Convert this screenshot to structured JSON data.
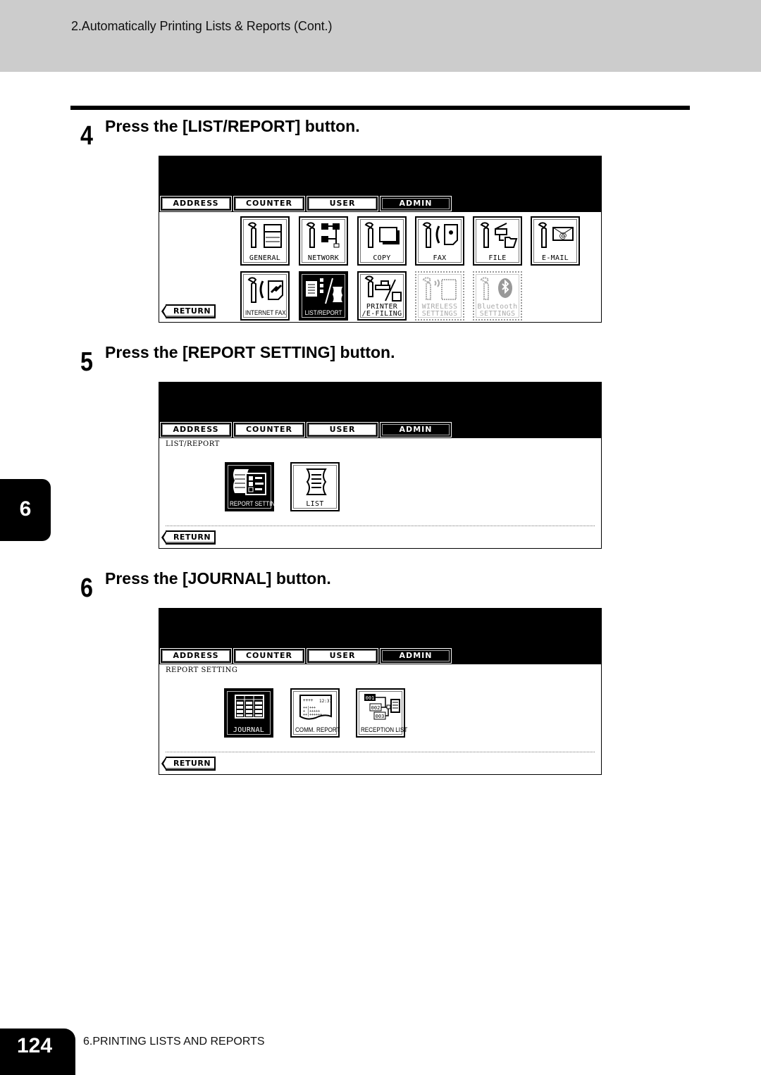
{
  "header": {
    "title": "2.Automatically Printing Lists & Reports (Cont.)"
  },
  "chapter_tab": "6",
  "steps": [
    {
      "number": "4",
      "text": "Press the [LIST/REPORT] button."
    },
    {
      "number": "5",
      "text": "Press the [REPORT SETTING] button."
    },
    {
      "number": "6",
      "text": "Press the [JOURNAL] button."
    }
  ],
  "screen_tabs": [
    "ADDRESS",
    "COUNTER",
    "USER",
    "ADMIN"
  ],
  "active_tab": "ADMIN",
  "return_label": "RETURN",
  "screen1": {
    "buttons": [
      {
        "label": "GENERAL",
        "icon": "general-icon",
        "state": "normal"
      },
      {
        "label": "NETWORK",
        "icon": "network-icon",
        "state": "normal"
      },
      {
        "label": "COPY",
        "icon": "copy-icon",
        "state": "normal"
      },
      {
        "label": "FAX",
        "icon": "fax-icon",
        "state": "normal"
      },
      {
        "label": "FILE",
        "icon": "file-icon",
        "state": "normal"
      },
      {
        "label": "E-MAIL",
        "icon": "email-icon",
        "state": "normal"
      },
      {
        "label": "INTERNET FAX",
        "icon": "internet-fax-icon",
        "state": "normal"
      },
      {
        "label": "LIST/REPORT",
        "icon": "list-report-icon",
        "state": "selected"
      },
      {
        "label": "PRINTER\n/E-FILING",
        "icon": "printer-efiling-icon",
        "state": "normal"
      },
      {
        "label": "WIRELESS\nSETTINGS",
        "icon": "wireless-settings-icon",
        "state": "disabled"
      },
      {
        "label": "Bluetooth\nSETTINGS",
        "icon": "bluetooth-settings-icon",
        "state": "disabled"
      }
    ]
  },
  "screen2": {
    "breadcrumb": "LIST/REPORT",
    "buttons": [
      {
        "label": "REPORT SETTING",
        "icon": "report-setting-icon",
        "state": "selected"
      },
      {
        "label": "LIST",
        "icon": "list-icon",
        "state": "normal"
      }
    ]
  },
  "screen3": {
    "breadcrumb": "REPORT SETTING",
    "buttons": [
      {
        "label": "JOURNAL",
        "icon": "journal-icon",
        "state": "selected"
      },
      {
        "label": "COMM. REPORT",
        "icon": "comm-report-icon",
        "state": "normal"
      },
      {
        "label": "RECEPTION LIST",
        "icon": "reception-list-icon",
        "state": "normal"
      }
    ]
  },
  "footer": {
    "page_number": "124",
    "chapter_title": "6.PRINTING LISTS AND REPORTS"
  }
}
